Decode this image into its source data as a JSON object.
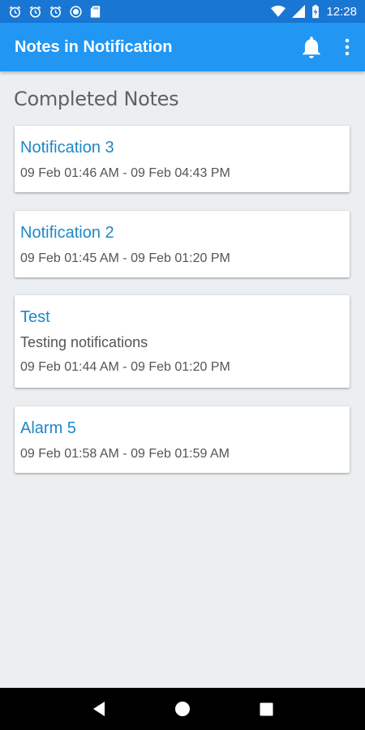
{
  "status_bar": {
    "time": "12:28",
    "icons": [
      "alarm-icon",
      "alarm-icon",
      "alarm-icon",
      "record-icon",
      "sd-card-icon",
      "wifi-icon",
      "signal-icon",
      "battery-charging-icon"
    ]
  },
  "app_bar": {
    "title": "Notes in Notification",
    "actions": [
      "bell-icon",
      "overflow-menu-icon"
    ],
    "color": "#2196f3"
  },
  "section": {
    "title": "Completed Notes"
  },
  "notes": [
    {
      "title": "Notification 3",
      "description": "",
      "time": "09 Feb 01:46 AM - 09 Feb 04:43 PM"
    },
    {
      "title": "Notification 2",
      "description": "",
      "time": "09 Feb 01:45 AM - 09 Feb 01:20 PM"
    },
    {
      "title": "Test",
      "description": "Testing notifications",
      "time": "09 Feb 01:44 AM - 09 Feb 01:20 PM"
    },
    {
      "title": "Alarm 5",
      "description": "",
      "time": "09 Feb 01:58 AM - 09 Feb 01:59 AM"
    }
  ],
  "nav_bar": {
    "buttons": [
      "back-icon",
      "home-icon",
      "recents-icon"
    ]
  }
}
